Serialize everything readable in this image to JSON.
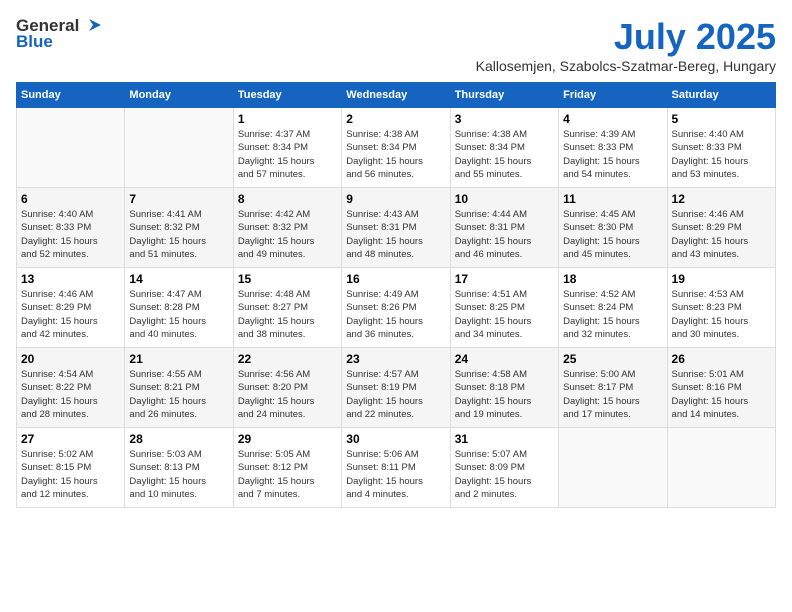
{
  "header": {
    "logo_general": "General",
    "logo_blue": "Blue",
    "month_title": "July 2025",
    "location": "Kallosemjen, Szabolcs-Szatmar-Bereg, Hungary"
  },
  "days_of_week": [
    "Sunday",
    "Monday",
    "Tuesday",
    "Wednesday",
    "Thursday",
    "Friday",
    "Saturday"
  ],
  "weeks": [
    {
      "days": [
        {
          "number": "",
          "info": ""
        },
        {
          "number": "",
          "info": ""
        },
        {
          "number": "1",
          "info": "Sunrise: 4:37 AM\nSunset: 8:34 PM\nDaylight: 15 hours\nand 57 minutes."
        },
        {
          "number": "2",
          "info": "Sunrise: 4:38 AM\nSunset: 8:34 PM\nDaylight: 15 hours\nand 56 minutes."
        },
        {
          "number": "3",
          "info": "Sunrise: 4:38 AM\nSunset: 8:34 PM\nDaylight: 15 hours\nand 55 minutes."
        },
        {
          "number": "4",
          "info": "Sunrise: 4:39 AM\nSunset: 8:33 PM\nDaylight: 15 hours\nand 54 minutes."
        },
        {
          "number": "5",
          "info": "Sunrise: 4:40 AM\nSunset: 8:33 PM\nDaylight: 15 hours\nand 53 minutes."
        }
      ]
    },
    {
      "days": [
        {
          "number": "6",
          "info": "Sunrise: 4:40 AM\nSunset: 8:33 PM\nDaylight: 15 hours\nand 52 minutes."
        },
        {
          "number": "7",
          "info": "Sunrise: 4:41 AM\nSunset: 8:32 PM\nDaylight: 15 hours\nand 51 minutes."
        },
        {
          "number": "8",
          "info": "Sunrise: 4:42 AM\nSunset: 8:32 PM\nDaylight: 15 hours\nand 49 minutes."
        },
        {
          "number": "9",
          "info": "Sunrise: 4:43 AM\nSunset: 8:31 PM\nDaylight: 15 hours\nand 48 minutes."
        },
        {
          "number": "10",
          "info": "Sunrise: 4:44 AM\nSunset: 8:31 PM\nDaylight: 15 hours\nand 46 minutes."
        },
        {
          "number": "11",
          "info": "Sunrise: 4:45 AM\nSunset: 8:30 PM\nDaylight: 15 hours\nand 45 minutes."
        },
        {
          "number": "12",
          "info": "Sunrise: 4:46 AM\nSunset: 8:29 PM\nDaylight: 15 hours\nand 43 minutes."
        }
      ]
    },
    {
      "days": [
        {
          "number": "13",
          "info": "Sunrise: 4:46 AM\nSunset: 8:29 PM\nDaylight: 15 hours\nand 42 minutes."
        },
        {
          "number": "14",
          "info": "Sunrise: 4:47 AM\nSunset: 8:28 PM\nDaylight: 15 hours\nand 40 minutes."
        },
        {
          "number": "15",
          "info": "Sunrise: 4:48 AM\nSunset: 8:27 PM\nDaylight: 15 hours\nand 38 minutes."
        },
        {
          "number": "16",
          "info": "Sunrise: 4:49 AM\nSunset: 8:26 PM\nDaylight: 15 hours\nand 36 minutes."
        },
        {
          "number": "17",
          "info": "Sunrise: 4:51 AM\nSunset: 8:25 PM\nDaylight: 15 hours\nand 34 minutes."
        },
        {
          "number": "18",
          "info": "Sunrise: 4:52 AM\nSunset: 8:24 PM\nDaylight: 15 hours\nand 32 minutes."
        },
        {
          "number": "19",
          "info": "Sunrise: 4:53 AM\nSunset: 8:23 PM\nDaylight: 15 hours\nand 30 minutes."
        }
      ]
    },
    {
      "days": [
        {
          "number": "20",
          "info": "Sunrise: 4:54 AM\nSunset: 8:22 PM\nDaylight: 15 hours\nand 28 minutes."
        },
        {
          "number": "21",
          "info": "Sunrise: 4:55 AM\nSunset: 8:21 PM\nDaylight: 15 hours\nand 26 minutes."
        },
        {
          "number": "22",
          "info": "Sunrise: 4:56 AM\nSunset: 8:20 PM\nDaylight: 15 hours\nand 24 minutes."
        },
        {
          "number": "23",
          "info": "Sunrise: 4:57 AM\nSunset: 8:19 PM\nDaylight: 15 hours\nand 22 minutes."
        },
        {
          "number": "24",
          "info": "Sunrise: 4:58 AM\nSunset: 8:18 PM\nDaylight: 15 hours\nand 19 minutes."
        },
        {
          "number": "25",
          "info": "Sunrise: 5:00 AM\nSunset: 8:17 PM\nDaylight: 15 hours\nand 17 minutes."
        },
        {
          "number": "26",
          "info": "Sunrise: 5:01 AM\nSunset: 8:16 PM\nDaylight: 15 hours\nand 14 minutes."
        }
      ]
    },
    {
      "days": [
        {
          "number": "27",
          "info": "Sunrise: 5:02 AM\nSunset: 8:15 PM\nDaylight: 15 hours\nand 12 minutes."
        },
        {
          "number": "28",
          "info": "Sunrise: 5:03 AM\nSunset: 8:13 PM\nDaylight: 15 hours\nand 10 minutes."
        },
        {
          "number": "29",
          "info": "Sunrise: 5:05 AM\nSunset: 8:12 PM\nDaylight: 15 hours\nand 7 minutes."
        },
        {
          "number": "30",
          "info": "Sunrise: 5:06 AM\nSunset: 8:11 PM\nDaylight: 15 hours\nand 4 minutes."
        },
        {
          "number": "31",
          "info": "Sunrise: 5:07 AM\nSunset: 8:09 PM\nDaylight: 15 hours\nand 2 minutes."
        },
        {
          "number": "",
          "info": ""
        },
        {
          "number": "",
          "info": ""
        }
      ]
    }
  ]
}
